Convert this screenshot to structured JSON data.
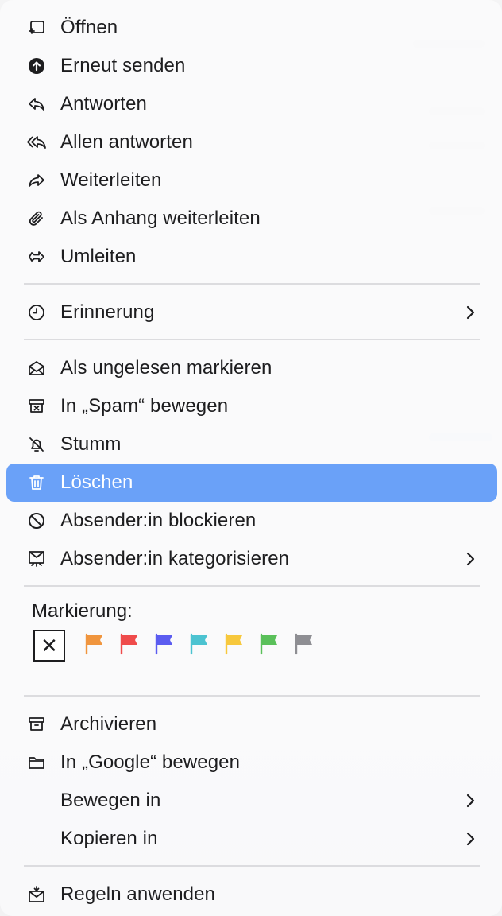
{
  "menu": {
    "items": [
      {
        "label": "Öffnen",
        "icon": "open-window-icon"
      },
      {
        "label": "Erneut senden",
        "icon": "resend-icon"
      },
      {
        "label": "Antworten",
        "icon": "reply-icon"
      },
      {
        "label": "Allen antworten",
        "icon": "reply-all-icon"
      },
      {
        "label": "Weiterleiten",
        "icon": "forward-icon"
      },
      {
        "label": "Als Anhang weiterleiten",
        "icon": "paperclip-icon"
      },
      {
        "label": "Umleiten",
        "icon": "redirect-icon"
      },
      {
        "label": "Erinnerung",
        "icon": "clock-icon",
        "submenu": true
      },
      {
        "label": "Als ungelesen markieren",
        "icon": "envelope-open-icon"
      },
      {
        "label": "In „Spam“ bewegen",
        "icon": "spam-box-icon"
      },
      {
        "label": "Stumm",
        "icon": "bell-slash-icon"
      },
      {
        "label": "Löschen",
        "icon": "trash-icon",
        "selected": true
      },
      {
        "label": "Absender:in blockieren",
        "icon": "block-icon"
      },
      {
        "label": "Absender:in kategorisieren",
        "icon": "categorize-icon",
        "submenu": true
      },
      {
        "label": "Archivieren",
        "icon": "archive-box-icon"
      },
      {
        "label": "In „Google“ bewegen",
        "icon": "folder-icon"
      },
      {
        "label": "Bewegen in",
        "icon": "",
        "submenu": true
      },
      {
        "label": "Kopieren in",
        "icon": "",
        "submenu": true
      },
      {
        "label": "Regeln anwenden",
        "icon": "rules-envelope-icon"
      }
    ],
    "flag_section": {
      "label": "Markierung:",
      "clear_symbol": "✕",
      "flags": [
        {
          "name": "orange",
          "color": "#f0953e"
        },
        {
          "name": "red",
          "color": "#ef4b4b"
        },
        {
          "name": "purple",
          "color": "#5b5cf0"
        },
        {
          "name": "teal",
          "color": "#4cc3d1"
        },
        {
          "name": "yellow",
          "color": "#f7c83d"
        },
        {
          "name": "green",
          "color": "#5ac05a"
        },
        {
          "name": "gray",
          "color": "#8e8e93"
        }
      ]
    },
    "selected_color": "#6aa1f8"
  }
}
